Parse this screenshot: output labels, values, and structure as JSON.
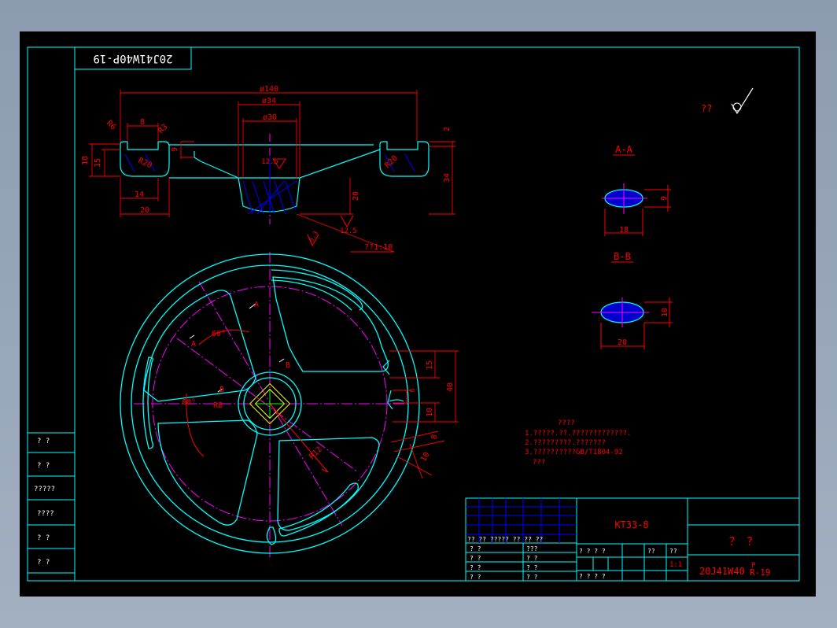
{
  "colors": {
    "background": "#000000",
    "frame": "#00ffff",
    "outline": "#00ffff",
    "dimension": "#ff0000",
    "centerline": "#ff00ff",
    "hatch": "#0000ff",
    "text_white": "#ffffff",
    "section_fill": "#ffff00"
  },
  "title_block": {
    "drawing_code_mirrored": "20J41W40P-19",
    "code_main": "20J41W40",
    "code_sup": "P",
    "code_sub": "R-19",
    "part_name": "KT33-8",
    "title_placeholder": "？  ？",
    "scale": "1:1",
    "labels": {
      "r_header": "??  ??   ?????     ??  ??  ??",
      "r1c1": "? ?",
      "r2c1": "? ?",
      "r3c1": "? ?",
      "r4c1": "? ?",
      "r1c2": "???",
      "r2c2": "? ?",
      "r3c2": "? ?",
      "r4c2": "? ?",
      "stage_label": "? ? ? ?",
      "weight_label": "??",
      "scale_label": "??",
      "sheet_row": "?      ?        ?      ?"
    }
  },
  "left_strip": {
    "items": [
      "? ?",
      "? ?",
      "?????",
      "????",
      "? ?",
      "? ?"
    ]
  },
  "roughness_note": "??",
  "sections": {
    "aa_title": "A-A",
    "bb_title": "B-B",
    "aa_width": "18",
    "aa_height": "9",
    "bb_width": "20",
    "bb_height": "10"
  },
  "section_marks": {
    "a1": "A",
    "a2": "A",
    "b1": "B",
    "b2": "B"
  },
  "top_view_dims": {
    "d140": "ø140",
    "d34": "ø34",
    "d30": "ø30",
    "r6": "R6",
    "w8": "8",
    "r3": "R3",
    "h18": "18",
    "h15": "15",
    "r20a": "R20",
    "w14": "14",
    "w20": "20",
    "h9": "9",
    "rough12_5a": "12.5",
    "rough12_5b": "12.5",
    "rough6_3": "6.3",
    "h20": "20",
    "h34": "34",
    "h2": "2",
    "r20b": "R20",
    "taper": "??1:10"
  },
  "plan_view_dims": {
    "ang60a": "60°",
    "ang60b": "60°",
    "r8": "R8",
    "r12": "R12",
    "h15": "15",
    "h40": "40",
    "h10": "10",
    "h8": "8",
    "h10b": "10",
    "h6": "6"
  },
  "notes": {
    "heading": "????",
    "line1": "1.?????.??.?????????????.",
    "line2": "2.?????????.???????",
    "line3": "3.??????????GB/T1804-92",
    "line4": "???"
  }
}
